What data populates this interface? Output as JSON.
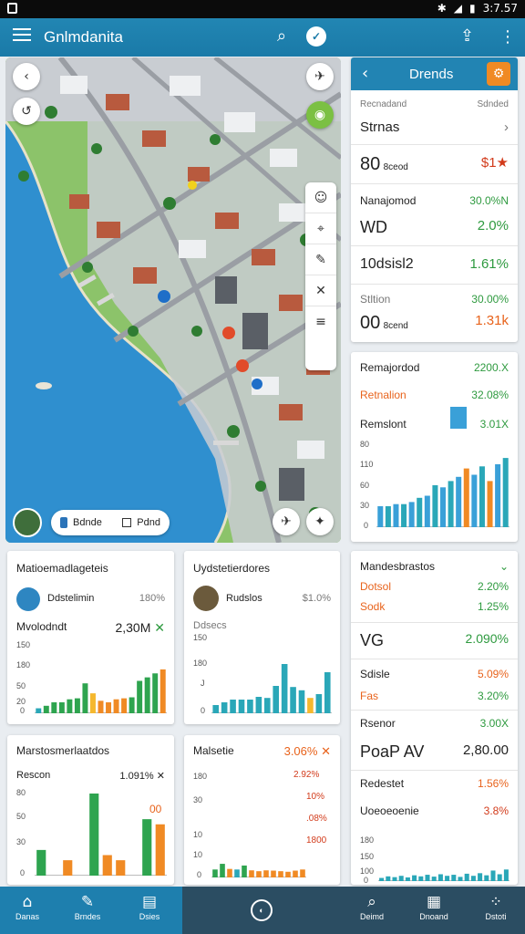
{
  "status_bar": {
    "time": "3:7.57"
  },
  "app_bar": {
    "title": "Gnlmdanita"
  },
  "map": {
    "legend_left": "Bdnde",
    "legend_right": "Pdnd"
  },
  "side": {
    "header_title": "Drends",
    "section1_label": "Recnadand",
    "section1_right": "Sdnded",
    "rows": [
      {
        "label": "Strnas",
        "value": ""
      },
      {
        "label": "80",
        "sub": "8ceod",
        "value": "$1★"
      },
      {
        "label": "Nanajomod",
        "value": "30.0%N"
      },
      {
        "label": "WD",
        "value": "2.0%"
      },
      {
        "label": "10dsisl2",
        "value": "1.61%"
      },
      {
        "label": "Stltion",
        "value": "30.00%"
      },
      {
        "label": "00",
        "sub": "8cend",
        "value": "1.31k"
      }
    ]
  },
  "mid_right": {
    "rows": [
      {
        "label": "Remajordod",
        "value": "2200.X"
      },
      {
        "label": "Retnalion",
        "value": "32.08%"
      },
      {
        "label": "Remslont",
        "value": "3.01X"
      }
    ],
    "axis": [
      "80",
      "110",
      "60",
      "30",
      "0"
    ]
  },
  "card1": {
    "title": "Matioemadlageteis",
    "sub_label": "Ddstelimin",
    "sub_value": "180%",
    "metric_label": "Mvolodndt",
    "metric_value": "2,30M",
    "axis": [
      "150",
      "180",
      "50",
      "20",
      "0"
    ]
  },
  "card2": {
    "title": "Uydstetierdores",
    "sub_label": "Rudslos",
    "sub_value": "$1.0%",
    "metric_label": "Ddsecs",
    "axis": [
      "150",
      "180",
      "J",
      "0"
    ]
  },
  "card3": {
    "title": "Marstosmerlaatdos",
    "sub_label": "Rescon",
    "sub_value": "1.091%",
    "highlight": "00",
    "axis": [
      "80",
      "50",
      "30",
      "0"
    ]
  },
  "card4": {
    "title": "Malsetie",
    "sub_value": "3.06%",
    "rows": [
      "2.92%",
      "10%",
      ".08%",
      "1800"
    ],
    "axis": [
      "180",
      "30",
      "10",
      "10",
      "0"
    ]
  },
  "right_bottom": {
    "title": "Mandesbrastos",
    "rows": [
      {
        "label": "Dotsol",
        "value": "2.20%"
      },
      {
        "label": "Sodk",
        "value": "1.25%"
      },
      {
        "label": "VG",
        "value": "2.090%"
      },
      {
        "label": "Sdisle",
        "value": "5.09%"
      },
      {
        "label": "Fas",
        "value": "3.20%"
      },
      {
        "label": "Rsenor",
        "value": "3.00X"
      },
      {
        "label": "PoaP AV",
        "value": "2,80.00"
      },
      {
        "label": "Redestet",
        "value": "1.56%"
      },
      {
        "label": "Uoeoeoenie",
        "value": "3.8%"
      }
    ],
    "axis": [
      "180",
      "150",
      "100",
      "0"
    ]
  },
  "bottom_nav": {
    "items": [
      "Danas",
      "Brndes",
      "Dsies",
      "Deimd",
      "Dnoand",
      "Dstoti"
    ]
  },
  "chart_data": [
    {
      "type": "bar",
      "title": "Remajordod",
      "values": [
        20,
        20,
        22,
        22,
        24,
        28,
        30,
        40,
        38,
        44,
        48,
        56,
        50,
        58,
        44,
        60,
        66
      ],
      "ylim": [
        0,
        80
      ]
    },
    {
      "type": "bar",
      "title": "Matioemadlageteis",
      "values": [
        10,
        15,
        22,
        22,
        28,
        30,
        60,
        40,
        25,
        22,
        28,
        30,
        32,
        65,
        72,
        80,
        88
      ],
      "ylim": [
        0,
        150
      ]
    },
    {
      "type": "bar",
      "title": "Uydstetierdores",
      "values": [
        15,
        20,
        25,
        25,
        25,
        30,
        28,
        50,
        90,
        48,
        42,
        28,
        35,
        75
      ],
      "ylim": [
        0,
        150
      ]
    },
    {
      "type": "bar",
      "title": "Marstosmerlaatdos",
      "values": [
        25,
        0,
        15,
        0,
        85,
        20,
        15,
        0,
        55,
        50
      ],
      "ylim": [
        0,
        80
      ]
    },
    {
      "type": "bar",
      "title": "Malsetie",
      "values": [
        28,
        48,
        30,
        28,
        42,
        25,
        22,
        25,
        24,
        22,
        20,
        24,
        28
      ],
      "ylim": [
        0,
        180
      ]
    },
    {
      "type": "bar",
      "title": "Mandesbrastos",
      "values": [
        12,
        18,
        15,
        20,
        14,
        22,
        18,
        24,
        17,
        26,
        20,
        24,
        16,
        28,
        20,
        30,
        22,
        40,
        26,
        44
      ],
      "ylim": [
        0,
        180
      ]
    }
  ]
}
